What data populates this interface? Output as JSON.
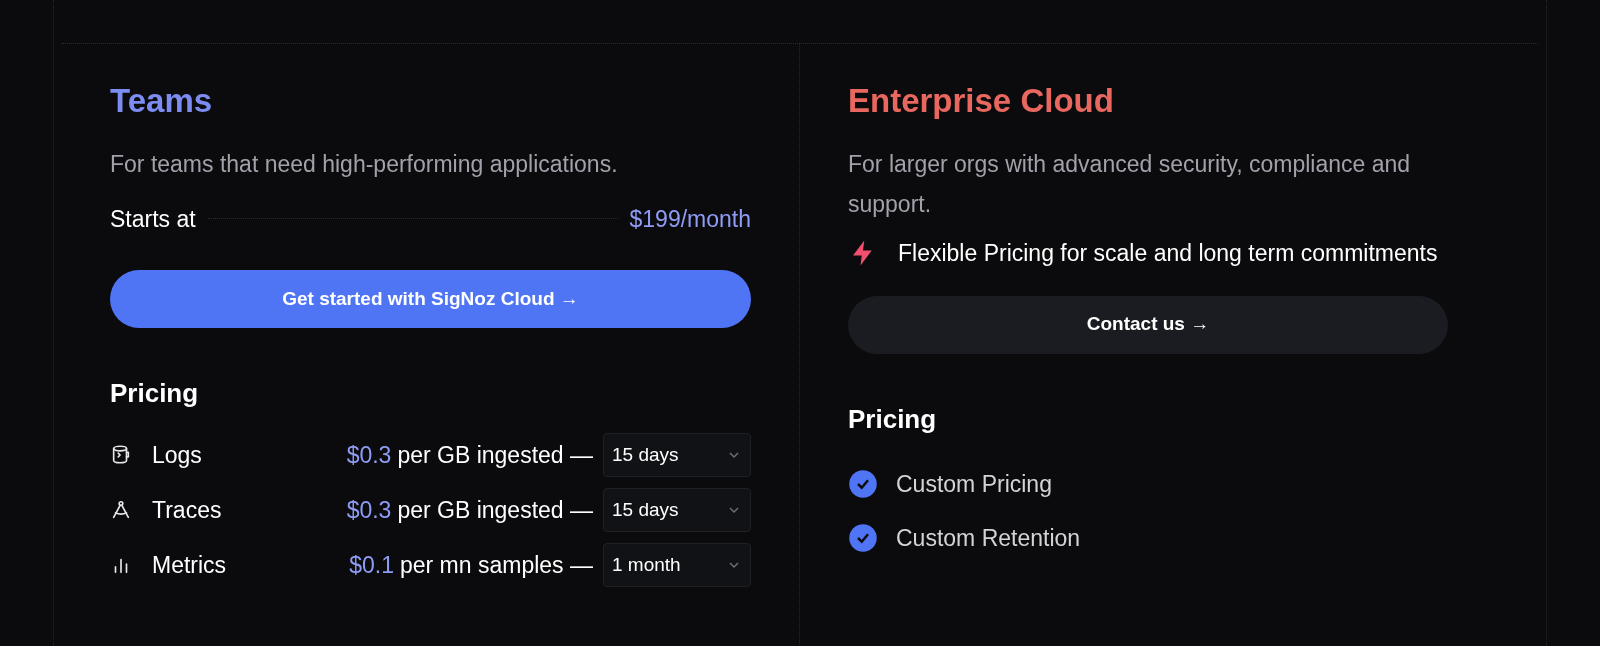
{
  "plans": [
    {
      "name": "Teams",
      "color": "#7c8cf0",
      "description": "For teams that need high-performing applications.",
      "starts_label": "Starts at",
      "starts_price": "$199/month",
      "cta": {
        "label": "Get started with SigNoz Cloud →",
        "kind": "primary"
      },
      "pricing_title": "Pricing",
      "rates": [
        {
          "kind": "logs",
          "label": "Logs",
          "price": "$0.3",
          "unit": "per GB ingested —",
          "retention": "15 days"
        },
        {
          "kind": "traces",
          "label": "Traces",
          "price": "$0.3",
          "unit": "per GB ingested —",
          "retention": "15 days"
        },
        {
          "kind": "metrics",
          "label": "Metrics",
          "price": "$0.1",
          "unit": "per mn samples —",
          "retention": "1 month"
        }
      ]
    },
    {
      "name": "Enterprise Cloud",
      "color": "#e8675f",
      "description": "For larger orgs with advanced security, compliance and support.",
      "highlight": "Flexible Pricing for scale and long term commitments",
      "cta": {
        "label": "Contact us →",
        "kind": "secondary"
      },
      "pricing_title": "Pricing",
      "features": [
        "Custom Pricing",
        "Custom Retention"
      ]
    }
  ]
}
